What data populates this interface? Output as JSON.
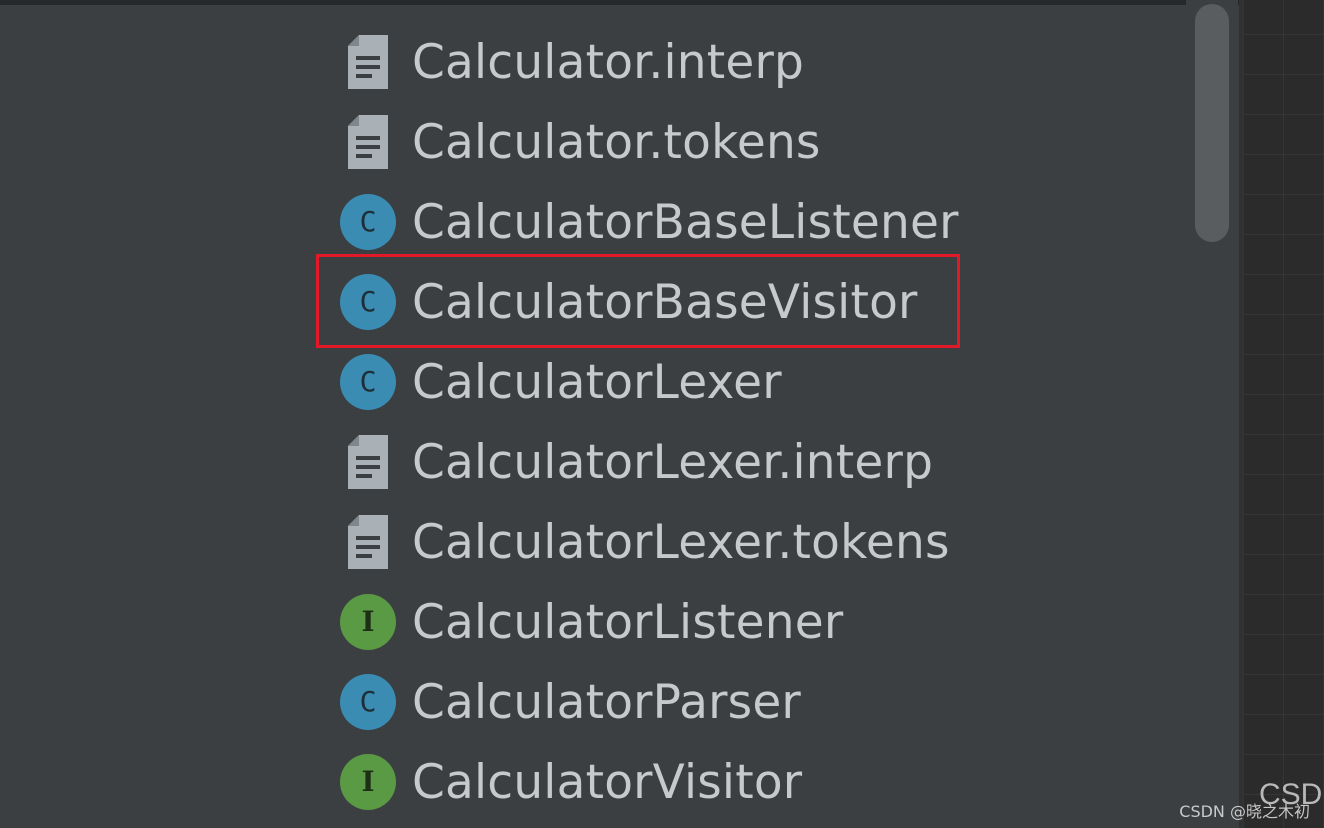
{
  "tree": {
    "items": [
      {
        "label": "Calculator.interp",
        "icon": "text-file-icon"
      },
      {
        "label": "Calculator.tokens",
        "icon": "text-file-icon"
      },
      {
        "label": "CalculatorBaseListener",
        "icon": "class-icon",
        "badge": "C"
      },
      {
        "label": "CalculatorBaseVisitor",
        "icon": "class-icon",
        "badge": "C",
        "highlighted": true
      },
      {
        "label": "CalculatorLexer",
        "icon": "class-icon",
        "badge": "C"
      },
      {
        "label": "CalculatorLexer.interp",
        "icon": "text-file-icon"
      },
      {
        "label": "CalculatorLexer.tokens",
        "icon": "text-file-icon"
      },
      {
        "label": "CalculatorListener",
        "icon": "interface-icon",
        "badge": "I"
      },
      {
        "label": "CalculatorParser",
        "icon": "class-icon",
        "badge": "C"
      },
      {
        "label": "CalculatorVisitor",
        "icon": "interface-icon",
        "badge": "I"
      }
    ]
  },
  "editor": {
    "visible_text": "CSD"
  },
  "watermark": "CSDN @晓之木初",
  "colors": {
    "background": "#3c3f41",
    "text": "#c7c9cb",
    "class_badge": "#3a8cb3",
    "interface_badge": "#5a9a44",
    "highlight_border": "#e3192a",
    "file_icon": "#a9b1b7"
  }
}
